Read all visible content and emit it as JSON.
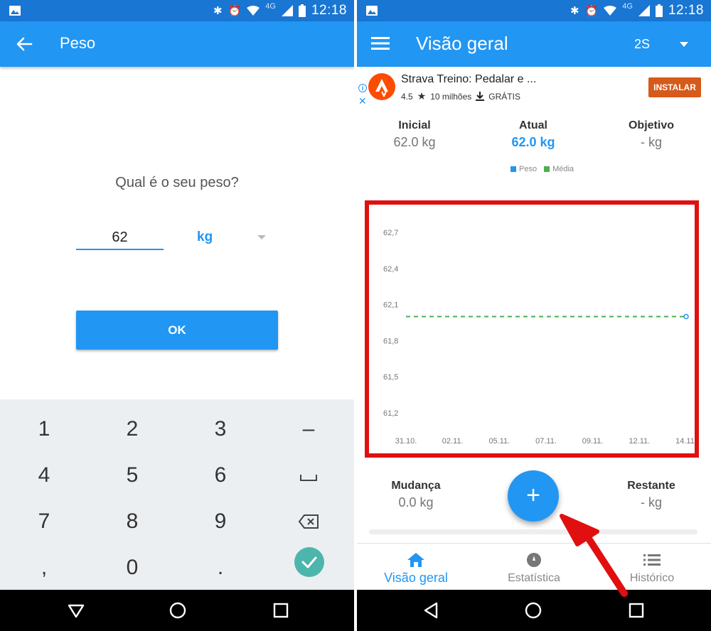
{
  "status_bar": {
    "time": "12:18",
    "network": "4G"
  },
  "left": {
    "toolbar": {
      "title": "Peso"
    },
    "question": "Qual é o seu peso?",
    "weight_input": {
      "value": "62"
    },
    "unit": {
      "selected": "kg"
    },
    "ok_label": "OK",
    "keypad": {
      "keys": [
        "1",
        "2",
        "3",
        "–",
        "4",
        "5",
        "6",
        "␣",
        "7",
        "8",
        "9",
        "⌫",
        ",",
        "0",
        ".",
        "✓"
      ]
    }
  },
  "right": {
    "toolbar": {
      "title": "Visão geral",
      "period": "2S"
    },
    "ad": {
      "title": "Strava Treino: Pedalar e ...",
      "rating": "4.5",
      "downloads": "10 milhões",
      "price": "GRÁTIS",
      "install_label": "INSTALAR"
    },
    "stats": {
      "initial": {
        "label": "Inicial",
        "value": "62.0 kg"
      },
      "current": {
        "label": "Atual",
        "value": "62.0 kg"
      },
      "goal": {
        "label": "Objetivo",
        "value": "- kg"
      },
      "change": {
        "label": "Mudança",
        "value": "0.0 kg"
      },
      "remaining": {
        "label": "Restante",
        "value": "- kg"
      }
    },
    "legend": {
      "weight": "Peso",
      "average": "Média"
    },
    "fab_label": "+",
    "bottom_nav": {
      "overview": "Visão geral",
      "stats": "Estatística",
      "history": "Histórico"
    }
  },
  "colors": {
    "primary": "#2196f3",
    "primary_dark": "#1976d2",
    "highlight": "#e01010",
    "average_line": "#4caf50",
    "confirm": "#4db6ac"
  },
  "chart_data": {
    "type": "line",
    "x": [
      "31.10.",
      "02.11.",
      "05.11.",
      "07.11.",
      "09.11.",
      "12.11.",
      "14.11."
    ],
    "y_ticks": [
      "62,7",
      "62,4",
      "62,1",
      "61,8",
      "61,5",
      "61,2"
    ],
    "ylim": [
      61.1,
      62.8
    ],
    "series": [
      {
        "name": "Peso",
        "points": [
          {
            "x": "14.11.",
            "y": 62.0
          }
        ]
      },
      {
        "name": "Média",
        "values": [
          62.0,
          62.0,
          62.0,
          62.0,
          62.0,
          62.0,
          62.0
        ],
        "style": "dashed"
      }
    ]
  }
}
